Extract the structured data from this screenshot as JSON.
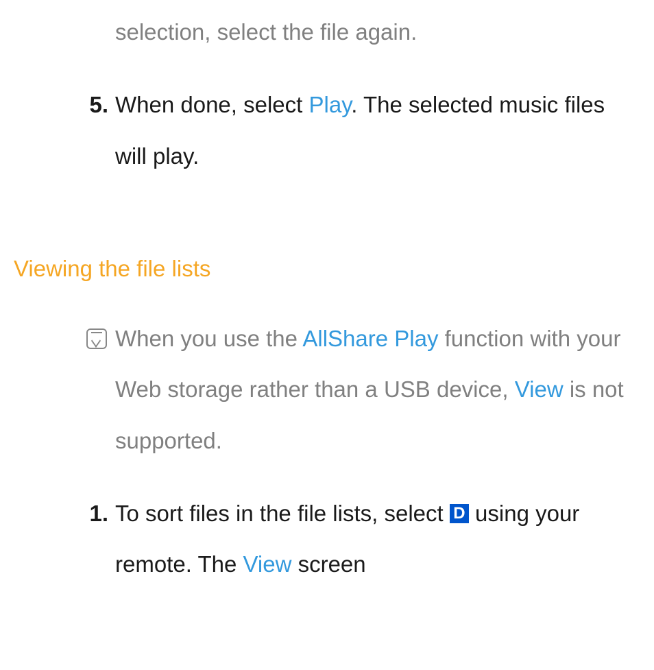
{
  "prev_step_fragment": "selection, select the file again.",
  "step5": {
    "number": "5.",
    "text_before": "When done, select ",
    "play_word": "Play",
    "text_after": ". The selected music files will play."
  },
  "section_heading": "Viewing the file lists",
  "note": {
    "text_1": "When you use the ",
    "allshare": "AllShare Play",
    "text_2": " function with your Web storage rather than a USB device, ",
    "view_word": "View",
    "text_3": " is not supported."
  },
  "step1": {
    "number": "1.",
    "text_1": "To sort files in the file lists, select ",
    "d_label": "D",
    "text_2": " using your remote. The ",
    "view_word": "View",
    "text_3": " screen"
  }
}
